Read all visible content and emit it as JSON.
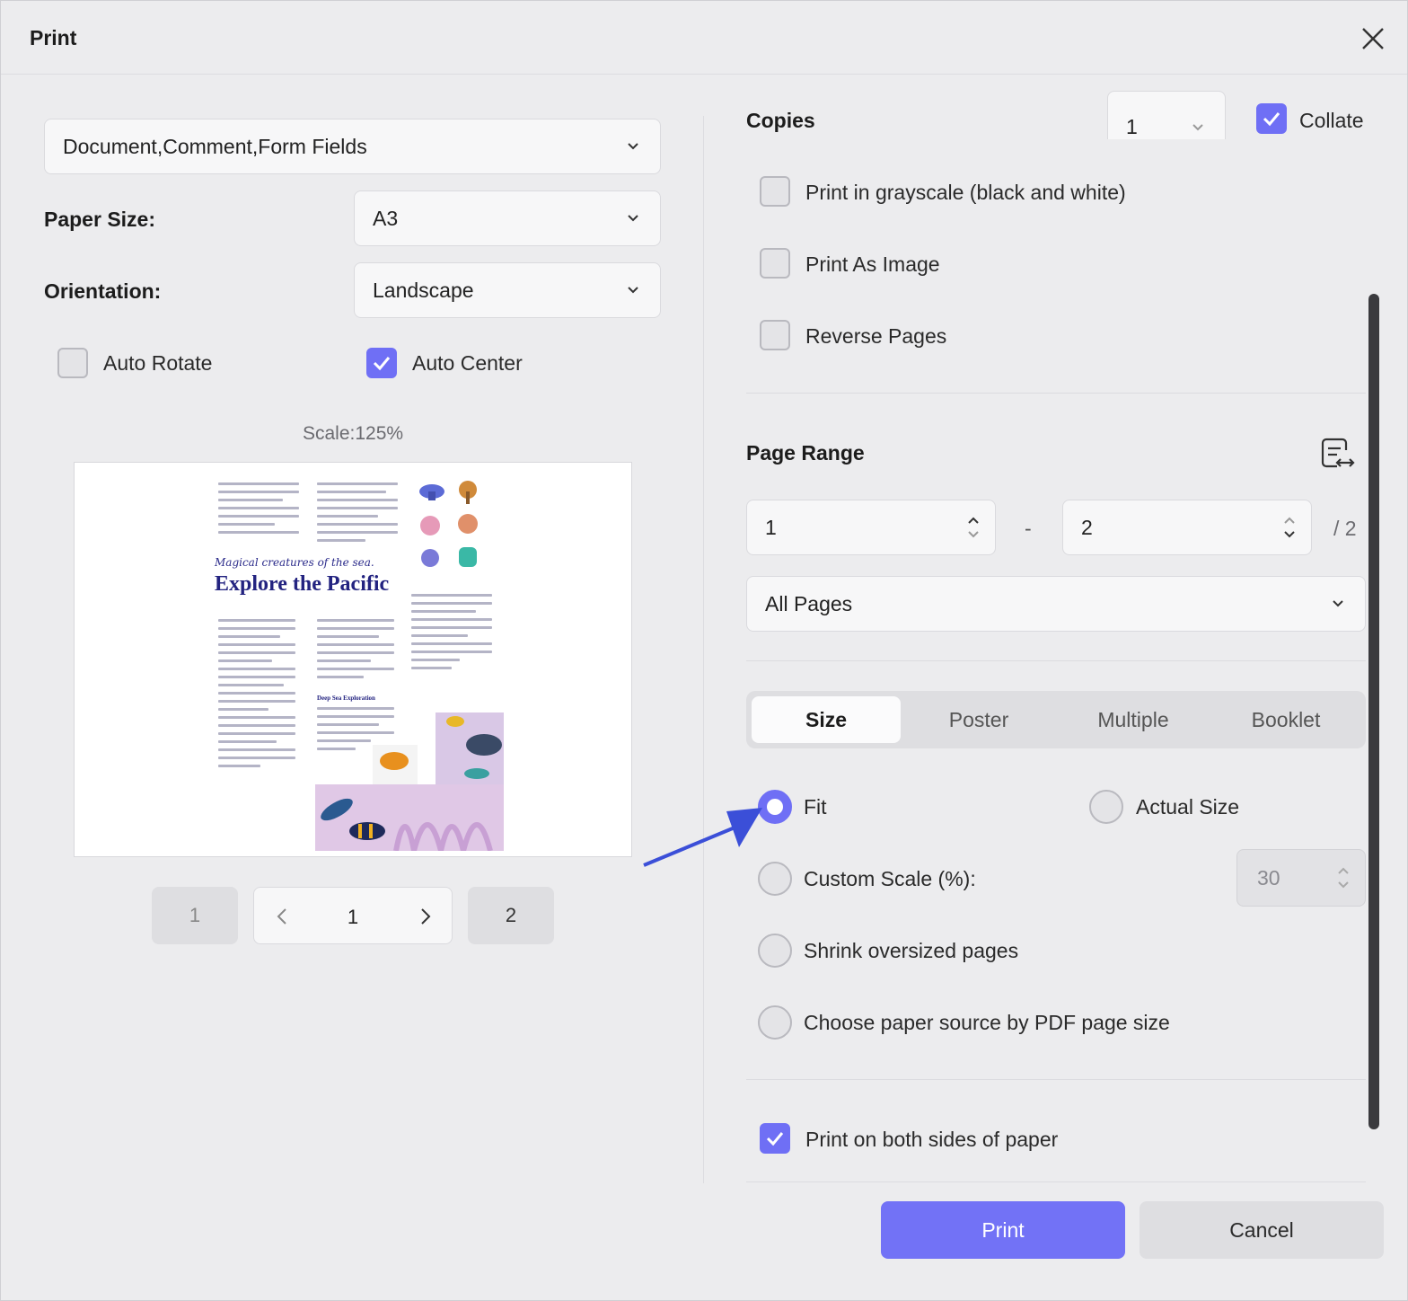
{
  "window": {
    "title": "Print"
  },
  "left": {
    "content_select": "Document,Comment,Form Fields",
    "paper_size_label": "Paper Size:",
    "paper_size_value": "A3",
    "orientation_label": "Orientation:",
    "orientation_value": "Landscape",
    "auto_rotate_label": "Auto Rotate",
    "auto_rotate_checked": false,
    "auto_center_label": "Auto Center",
    "auto_center_checked": true,
    "scale_text": "Scale:125%",
    "preview": {
      "subtitle": "Magical creatures of the sea.",
      "title": "Explore the Pacific",
      "section_heading": "Deep Sea Exploration"
    },
    "pager": {
      "first": "1",
      "current": "1",
      "last": "2"
    }
  },
  "right": {
    "copies_label": "Copies",
    "copies_value": "1",
    "collate_label": "Collate",
    "collate_checked": true,
    "grayscale_label": "Print in grayscale (black and white)",
    "print_as_image_label": "Print As Image",
    "reverse_pages_label": "Reverse Pages",
    "page_range_title": "Page Range",
    "range_from": "1",
    "range_dash": "-",
    "range_to": "2",
    "range_total": "/ 2",
    "pages_select": "All Pages",
    "tabs": [
      "Size",
      "Poster",
      "Multiple",
      "Booklet"
    ],
    "active_tab": "Size",
    "fit_label": "Fit",
    "actual_size_label": "Actual Size",
    "custom_scale_label": "Custom Scale (%):",
    "custom_scale_value": "30",
    "shrink_label": "Shrink oversized pages",
    "paper_source_label": "Choose paper source by PDF page size",
    "both_sides_label": "Print on both sides of paper",
    "both_sides_checked": true
  },
  "buttons": {
    "print": "Print",
    "cancel": "Cancel"
  },
  "colors": {
    "accent": "#7272f6",
    "annotation_arrow": "#3b4fd8"
  }
}
